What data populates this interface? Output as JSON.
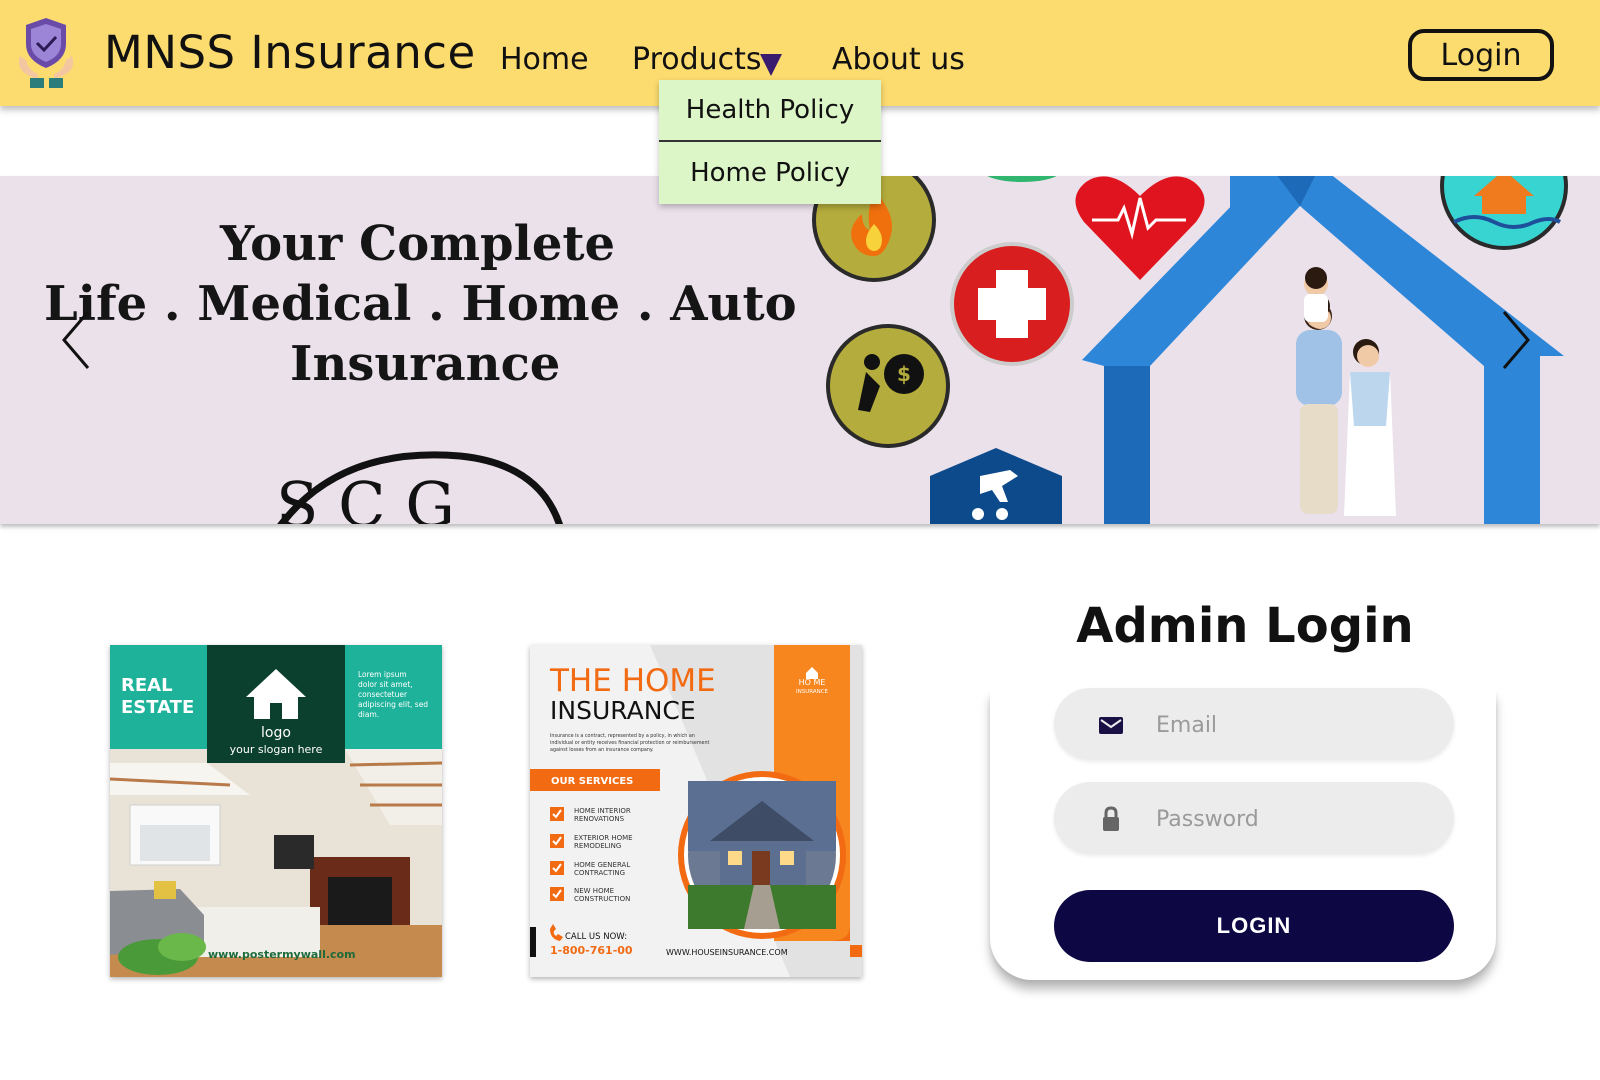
{
  "colors": {
    "header_bg": "#fcdc6e",
    "dropdown_bg": "#ddf6c8",
    "carousel_bg": "#ebe1eb",
    "login_button": "#0d0744",
    "poster_teal": "#1fb29a",
    "poster_orange": "#f26a12"
  },
  "header": {
    "brand": "MNSS Insurance",
    "logo_icon": "shield-check-hands-icon",
    "nav": {
      "home": "Home",
      "products": "Products",
      "about": "About us"
    },
    "login_label": "Login"
  },
  "products_dropdown": {
    "items": [
      "Health Policy",
      "Home Policy"
    ]
  },
  "carousel": {
    "headline_line1": "Your  Complete",
    "headline_line2": "Life  .  Medical  .  Home  .  Auto",
    "headline_line3": "Insurance",
    "partial_logo_text": "S C G",
    "prev_icon": "chevron-left-icon",
    "next_icon": "chevron-right-icon"
  },
  "poster_real_estate": {
    "title_line1": "REAL",
    "title_line2": "ESTATE",
    "logo_label": "logo",
    "slogan": "your slogan here",
    "blurb": [
      "Lorem ipsum",
      "dolor sit amet,",
      "consectetuer",
      "adipiscing elit, sed",
      "diam."
    ],
    "website": "www.postermywall.com"
  },
  "poster_home_insurance": {
    "title_line1": "THE HOME",
    "title_line2": "INSURANCE",
    "description": [
      "Insurance is a contract, represented by a policy, in which an",
      "individual or entity receives financial protection or reimbursement",
      "against losses from an insurance company."
    ],
    "services_label": "OUR SERVICES",
    "services": [
      [
        "HOME INTERIOR",
        "RENOVATIONS"
      ],
      [
        "EXTERIOR HOME",
        "REMODELING"
      ],
      [
        "HOME GENERAL",
        "CONTRACTING"
      ],
      [
        "NEW HOME",
        "CONSTRUCTION"
      ]
    ],
    "call_label": "CALL US NOW:",
    "phone": "1-800-761-00",
    "website": "WWW.HOUSEINSURANCE.COM",
    "badge_line1": "HO  ME",
    "badge_line2": "INSURANCE"
  },
  "admin_login": {
    "title": "Admin Login",
    "email_placeholder": "Email",
    "password_placeholder": "Password",
    "submit_label": "LOGIN",
    "email_icon": "envelope-icon",
    "password_icon": "lock-icon"
  }
}
